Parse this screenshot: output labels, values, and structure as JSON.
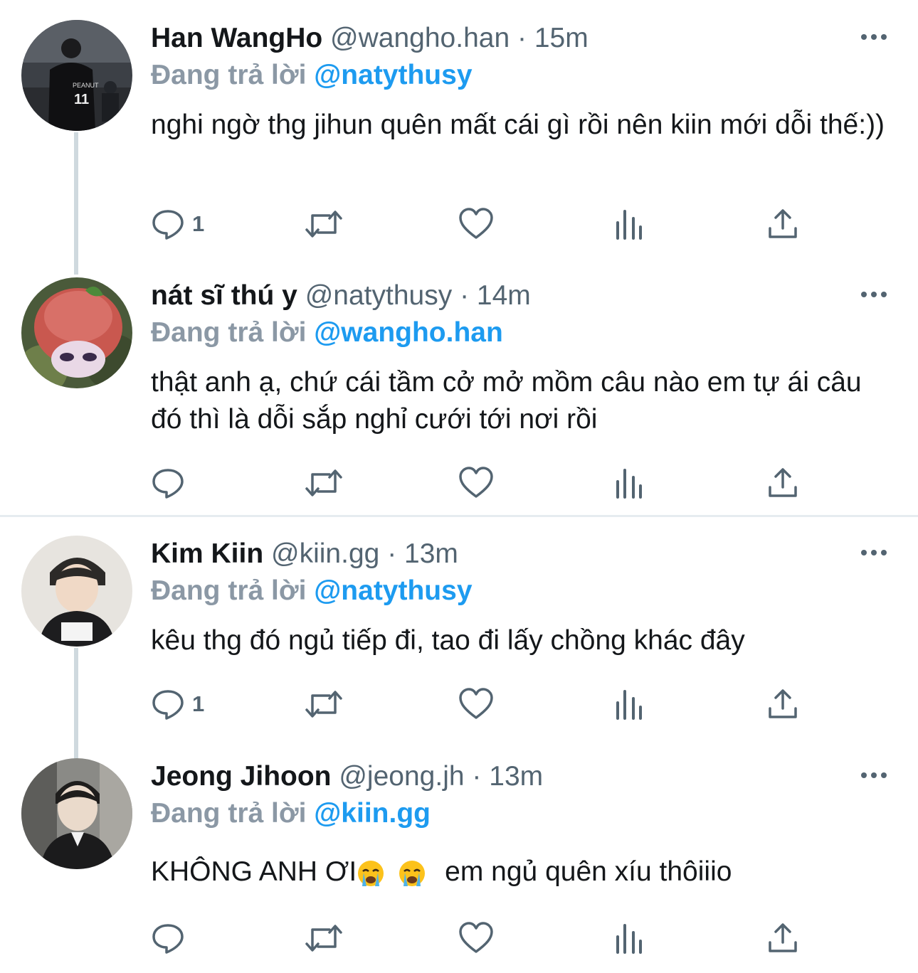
{
  "colors": {
    "link": "#1d9bf0",
    "muted": "#536471",
    "replying": "#8b98a5",
    "line": "#cfd9de"
  },
  "tweets": [
    {
      "name": "Han WangHo",
      "handle": "@wangho.han",
      "sep": "·",
      "time": "15m",
      "replying_prefix": "Đang trả lời",
      "replying_to": "@natythusy",
      "text": "nghi ngờ thg jihun quên mất cái gì rồi nên kiin mới dỗi thế:))",
      "reply_count": "1",
      "avatar_icon": "profile-photo-jersey-11"
    },
    {
      "name": "nát sĩ thú y",
      "handle": "@natythusy",
      "sep": "·",
      "time": "14m",
      "replying_prefix": "Đang trả lời",
      "replying_to": "@wangho.han",
      "text": "thật anh ạ, chứ cái tầm cở mở mồm câu nào em tự ái câu đó thì là dỗi sắp nghỉ cưới tới nơi rồi",
      "reply_count": "",
      "avatar_icon": "profile-photo-figurine"
    },
    {
      "name": "Kim Kiin",
      "handle": "@kiin.gg",
      "sep": "·",
      "time": "13m",
      "replying_prefix": "Đang trả lời",
      "replying_to": "@natythusy",
      "text": "kêu thg đó ngủ tiếp đi, tao đi lấy chồng khác đây",
      "reply_count": "1",
      "avatar_icon": "profile-photo-player"
    },
    {
      "name": "Jeong Jihoon",
      "handle": "@jeong.jh",
      "sep": "·",
      "time": "13m",
      "replying_prefix": "Đang trả lời",
      "replying_to": "@kiin.gg",
      "text_a": "KHÔNG ANH ƠI",
      "text_b": "em ngủ quên xíu thôiiio",
      "reply_count": "",
      "avatar_icon": "profile-photo-player-2"
    }
  ]
}
